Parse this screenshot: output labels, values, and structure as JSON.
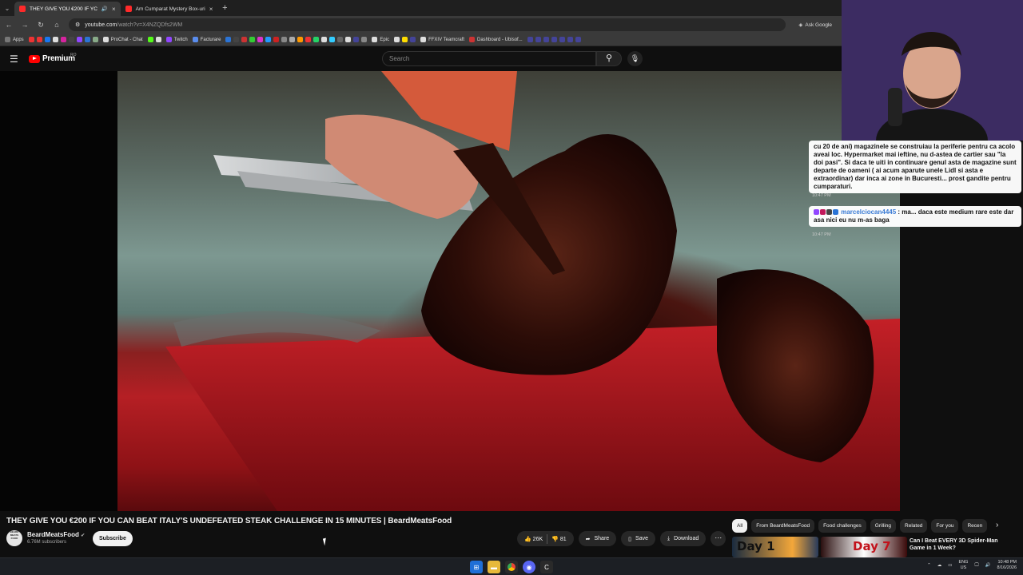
{
  "browser": {
    "tabs": [
      {
        "title": "THEY GIVE YOU €200 IF YC",
        "active": true
      },
      {
        "title": "Am Cumparat Mystery Box-uri",
        "active": false
      }
    ],
    "url_host": "youtube.com",
    "url_path": "/watch?v=X4NZQDfs2WM",
    "ask_google": "Ask Google",
    "bookmarks": [
      "Apps",
      "ProChat - Chat",
      "Twitch",
      "Facturare",
      "Epic",
      "FFXIV Teamcraft",
      "Dashboard - Ubisof..."
    ]
  },
  "youtube_header": {
    "brand": "Premium",
    "country": "RO",
    "search_placeholder": "Search"
  },
  "chat": {
    "messages": [
      {
        "text": "cu 20 de ani) magazinele se construiau la periferie pentru ca acolo aveai loc. Hypermarket mai ieftine, nu d-astea de cartier sau \"la doi pasi\". Si daca te uiti in continuare genul asta de magazine sunt departe de oameni ( ai acum aparute unele Lidl si asta e extraordinar) dar inca ai zone in Bucuresti... prost gandite pentru cumparaturi.",
        "time": "10:47 PM"
      },
      {
        "user": "marcelciocan4445",
        "text": ": ma... daca este medium rare este dar asa nici eu nu m-as baga",
        "time": "10:47 PM"
      }
    ]
  },
  "video": {
    "title": "THEY GIVE YOU €200 IF YOU CAN BEAT ITALY'S UNDEFEATED STEAK CHALLENGE IN 15 MINUTES | BeardMeatsFood",
    "channel_name": "BeardMeatsFood",
    "channel_avatar_text": "BEARD MEATS FOOD",
    "subscribers": "6.76M subscribers",
    "subscribe_label": "Subscribe",
    "likes": "26K",
    "dislikes": "81",
    "share_label": "Share",
    "save_label": "Save",
    "download_label": "Download"
  },
  "chips": [
    "All",
    "From BeardMeatsFood",
    "Food challenges",
    "Grilling",
    "Related",
    "For you",
    "Recen"
  ],
  "recommendation": {
    "title": "Can I Beat EVERY 3D Spider-Man Game in 1 Week?",
    "thumb1_text": "Day 1",
    "thumb2_text": "Day 7"
  },
  "taskbar": {
    "lang": "ENG",
    "region": "US",
    "time": "10:48 PM",
    "date": "8/16/2026"
  },
  "colors": {
    "youtube_red": "#ff0000",
    "chat_user": "#3a7bd5",
    "background": "#0f0f0f"
  }
}
